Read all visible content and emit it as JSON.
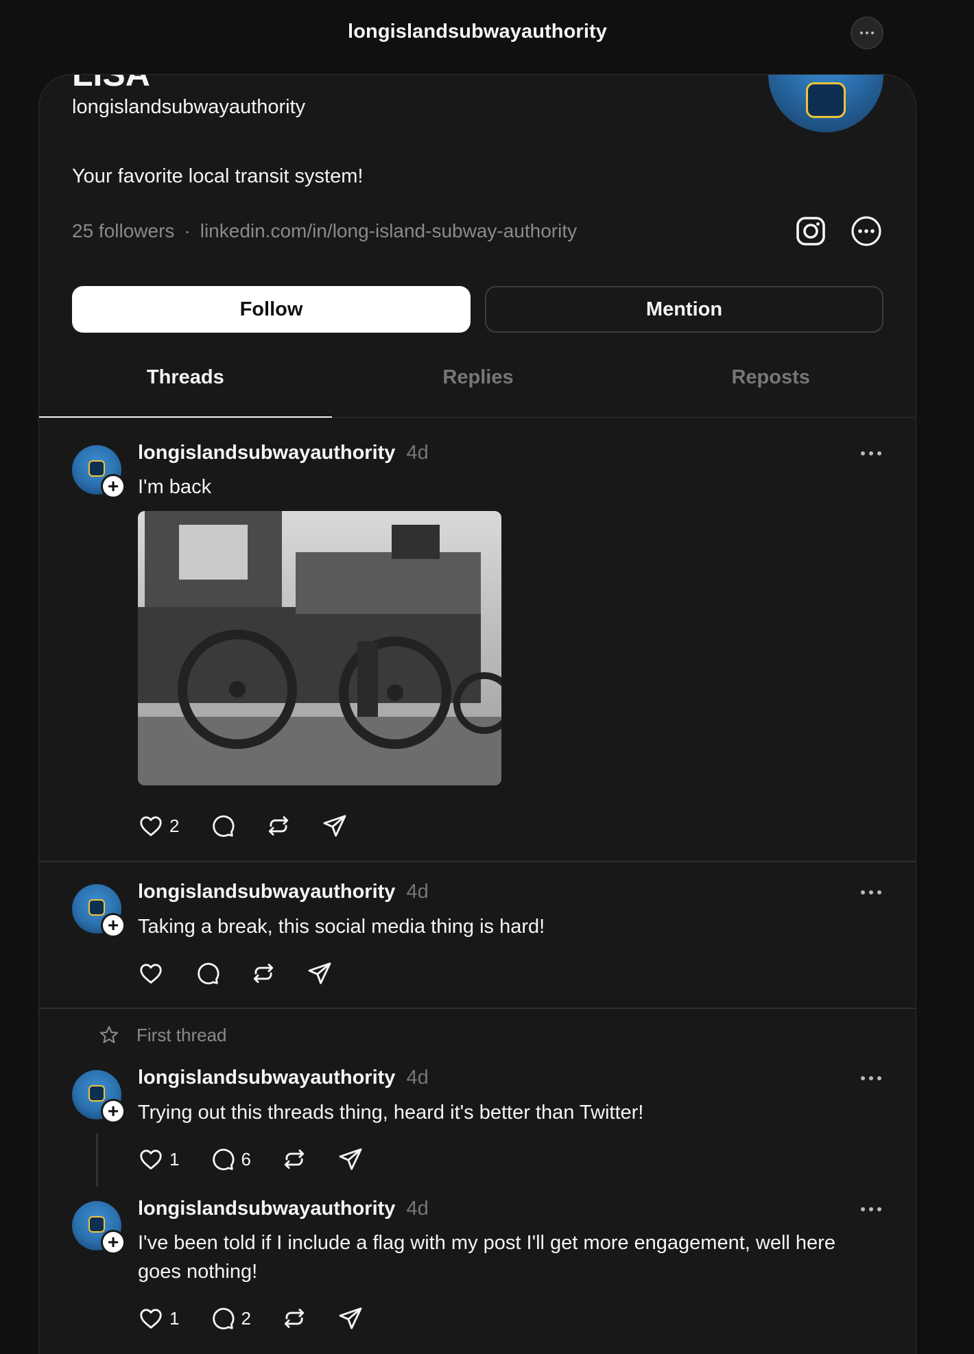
{
  "topbar": {
    "title": "longislandsubwayauthority"
  },
  "profile": {
    "display_name": "LISA",
    "handle": "longislandsubwayauthority",
    "bio": "Your favorite local transit system!",
    "followers": "25 followers",
    "separator": "·",
    "link": "linkedin.com/in/long-island-subway-authority",
    "follow_label": "Follow",
    "mention_label": "Mention"
  },
  "tabs": [
    {
      "label": "Threads",
      "active": true
    },
    {
      "label": "Replies",
      "active": false
    },
    {
      "label": "Reposts",
      "active": false
    }
  ],
  "pinned_label": "First thread",
  "posts": [
    {
      "author": "longislandsubwayauthority",
      "time": "4d",
      "text": "I'm back",
      "likes": "2",
      "replies": "",
      "has_image": true
    },
    {
      "author": "longislandsubwayauthority",
      "time": "4d",
      "text": "Taking a break, this social media thing is hard!",
      "likes": "",
      "replies": ""
    },
    {
      "author": "longislandsubwayauthority",
      "time": "4d",
      "text": "Trying out this threads thing, heard it's better than Twitter!",
      "likes": "1",
      "replies": "6"
    },
    {
      "author": "longislandsubwayauthority",
      "time": "4d",
      "text": "I've been told if I include a flag with my post I'll get more engagement, well here goes nothing!",
      "likes": "1",
      "replies": "2"
    }
  ],
  "icons": {
    "like": "heart-icon",
    "reply": "comment-icon",
    "repost": "repost-icon",
    "share": "share-icon",
    "more": "more-icon",
    "instagram": "instagram-icon",
    "pin": "star-icon"
  }
}
